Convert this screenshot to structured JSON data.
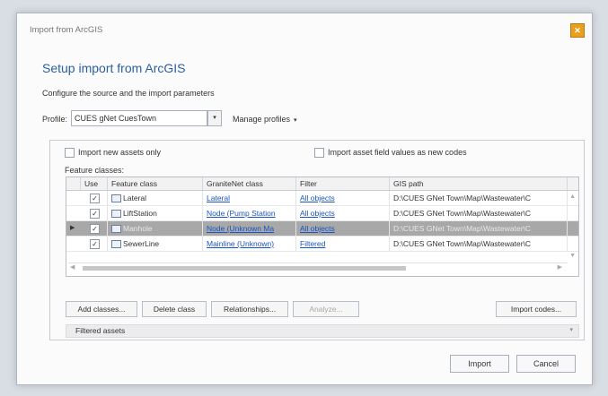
{
  "window": {
    "title": "Import from ArcGIS",
    "close_icon": "close-icon"
  },
  "header": {
    "heading": "Setup import from ArcGIS",
    "subtitle": "Configure the source and the import parameters"
  },
  "profile": {
    "label": "Profile:",
    "value": "CUES gNet CuesTown",
    "manage_label": "Manage profiles"
  },
  "options": {
    "import_new_only": "Import new assets only",
    "import_field_values": "Import asset field values as new codes"
  },
  "feature_classes_label": "Feature classes:",
  "grid": {
    "columns": [
      "Use",
      "Feature class",
      "GraniteNet class",
      "Filter",
      "GIS path"
    ],
    "rows": [
      {
        "use": "✓",
        "feature_class": "Lateral",
        "granitenet_class": "Lateral",
        "filter": "All objects",
        "gis_path": "D:\\CUES GNet Town\\Map\\Wastewater\\C",
        "selected": false
      },
      {
        "use": "✓",
        "feature_class": "LiftStation",
        "granitenet_class": "Node (Pump Station",
        "filter": "All objects",
        "gis_path": "D:\\CUES GNet Town\\Map\\Wastewater\\C",
        "selected": false
      },
      {
        "use": "✓",
        "feature_class": "Manhole",
        "granitenet_class": "Node (Unknown Ma",
        "filter": "All objects",
        "gis_path": "D:\\CUES GNet Town\\Map\\Wastewater\\C",
        "selected": true
      },
      {
        "use": "✓",
        "feature_class": "SewerLine",
        "granitenet_class": "Mainline (Unknown)",
        "filter": "Filtered",
        "gis_path": "D:\\CUES GNet Town\\Map\\Wastewater\\C",
        "selected": false
      }
    ]
  },
  "buttons": {
    "add_classes": "Add classes...",
    "delete_class": "Delete class",
    "relationships": "Relationships...",
    "analyze": "Analyze...",
    "import_codes": "Import codes..."
  },
  "filtered_assets": "Filtered assets",
  "footer": {
    "import": "Import",
    "cancel": "Cancel"
  }
}
